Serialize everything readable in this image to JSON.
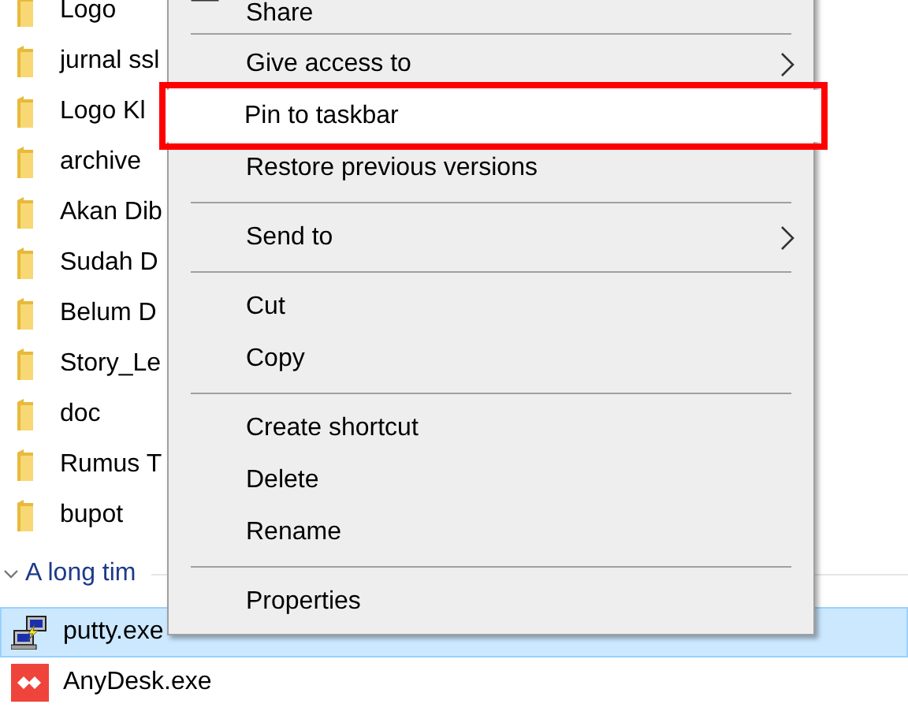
{
  "files": [
    {
      "name": "Logo",
      "selected": false
    },
    {
      "name": "jurnal ssl",
      "selected": false
    },
    {
      "name": "Logo Kl",
      "selected": false
    },
    {
      "name": "archive",
      "selected": false
    },
    {
      "name": "Akan Dib",
      "selected": false
    },
    {
      "name": "Sudah D",
      "selected": false
    },
    {
      "name": "Belum D",
      "selected": false
    },
    {
      "name": "Story_Le",
      "selected": false
    },
    {
      "name": "doc",
      "selected": false
    },
    {
      "name": "Rumus T",
      "selected": false
    },
    {
      "name": "bupot",
      "selected": false
    }
  ],
  "group": {
    "label": "A long tim",
    "expanded": true
  },
  "recent": [
    {
      "name": "putty.exe",
      "kind": "putty",
      "selected": true
    },
    {
      "name": "AnyDesk.exe",
      "kind": "anydesk",
      "selected": false
    }
  ],
  "context_menu": {
    "items": [
      {
        "kind": "icon-item",
        "label": "Share",
        "submenu": false,
        "highlighted": false
      },
      {
        "kind": "separator"
      },
      {
        "kind": "item",
        "label": "Give access to",
        "submenu": true,
        "highlighted": false
      },
      {
        "kind": "item",
        "label": "Pin to taskbar",
        "submenu": false,
        "highlighted": true
      },
      {
        "kind": "item",
        "label": "Restore previous versions",
        "submenu": false,
        "highlighted": false
      },
      {
        "kind": "separator"
      },
      {
        "kind": "item",
        "label": "Send to",
        "submenu": true,
        "highlighted": false
      },
      {
        "kind": "separator"
      },
      {
        "kind": "item",
        "label": "Cut",
        "submenu": false,
        "highlighted": false
      },
      {
        "kind": "item",
        "label": "Copy",
        "submenu": false,
        "highlighted": false
      },
      {
        "kind": "separator"
      },
      {
        "kind": "item",
        "label": "Create shortcut",
        "submenu": false,
        "highlighted": false
      },
      {
        "kind": "item",
        "label": "Delete",
        "submenu": false,
        "highlighted": false
      },
      {
        "kind": "item",
        "label": "Rename",
        "submenu": false,
        "highlighted": false
      },
      {
        "kind": "separator"
      },
      {
        "kind": "item",
        "label": "Properties",
        "submenu": false,
        "highlighted": false
      }
    ]
  }
}
